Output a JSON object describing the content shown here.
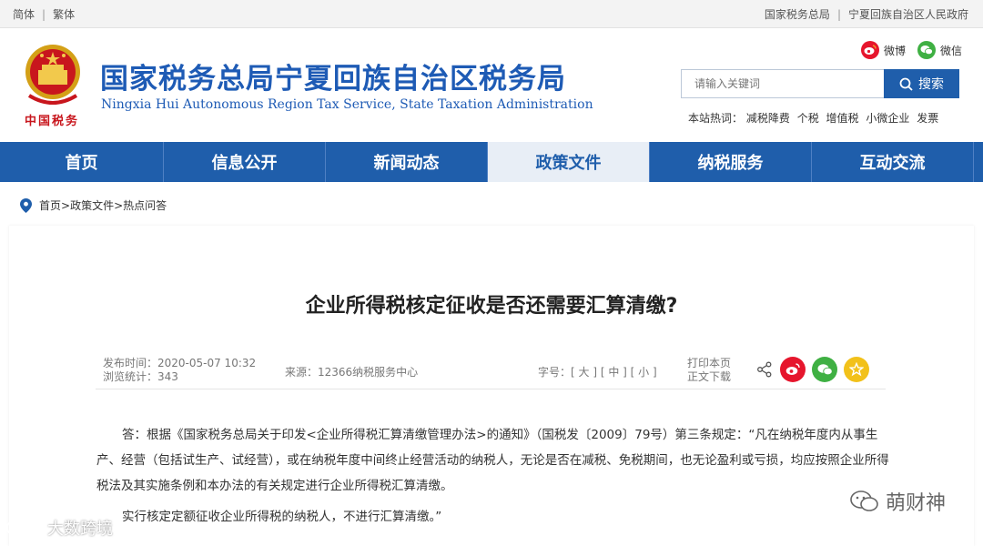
{
  "topbar": {
    "simplified": "简体",
    "traditional": "繁体",
    "link_sat": "国家税务总局",
    "link_gov": "宁夏回族自治区人民政府"
  },
  "header": {
    "emblem_text": "中国税务",
    "title": "国家税务总局宁夏回族自治区税务局",
    "subtitle": "Ningxia Hui Autonomous Region Tax Service, State Taxation Administration",
    "weibo_label": "微博",
    "wechat_label": "微信",
    "search_placeholder": "请输入关键词",
    "search_button": "搜索",
    "hot_label": "本站热词：",
    "hot_words": [
      "减税降费",
      "个税",
      "增值税",
      "小微企业",
      "发票"
    ]
  },
  "nav": {
    "items": [
      "首页",
      "信息公开",
      "新闻动态",
      "政策文件",
      "纳税服务",
      "互动交流"
    ],
    "active_index": 3
  },
  "breadcrumb": {
    "home": "首页",
    "level1": "政策文件",
    "level2": "热点问答",
    "sep": ">"
  },
  "article": {
    "title": "企业所得税核定征收是否还需要汇算清缴?",
    "publish_time": "发布时间：2020-05-07 10:32",
    "views": "浏览统计：343",
    "source": "来源：12366纳税服务中心",
    "font_label": "字号：",
    "font_large": "[ 大 ]",
    "font_medium": "[ 中 ]",
    "font_small": "[ 小 ]",
    "print": "打印本页",
    "download": "正文下载",
    "paragraph1": "答：根据《国家税务总局关于印发<企业所得税汇算清缴管理办法>的通知》（国税发〔2009〕79号）第三条规定：“凡在纳税年度内从事生产、经营（包括试生产、试经营），或在纳税年度中间终止经营活动的纳税人，无论是否在减税、免税期间，也无论盈利或亏损，均应按照企业所得税法及其实施条例和本办法的有关规定进行企业所得税汇算清缴。",
    "paragraph2": "实行核定定额征收企业所得税的纳税人，不进行汇算清缴。”"
  },
  "watermarks": {
    "right": "萌财神",
    "left": "大数跨境"
  },
  "colors": {
    "brand_blue": "#1f5eab",
    "title_blue": "#1e5bb5",
    "emblem_red": "#c8161d",
    "weibo_red": "#e6162d",
    "wechat_green": "#3fb043",
    "fav_yellow": "#f2c11a"
  },
  "icons": [
    "weibo-icon",
    "wechat-icon",
    "search-icon",
    "location-pin-icon",
    "share-icon",
    "star-icon"
  ]
}
